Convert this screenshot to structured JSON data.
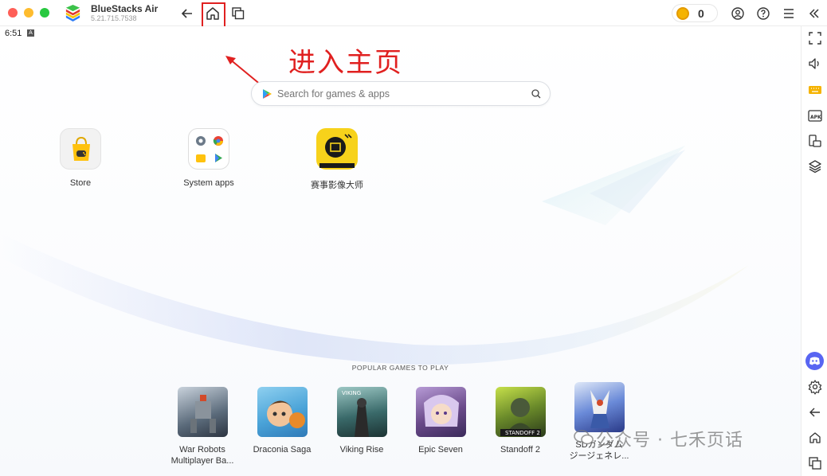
{
  "titlebar": {
    "app_name": "BlueStacks Air",
    "app_version": "5.21.715.7538",
    "coin_count": "0",
    "icons": [
      "back-arrow-icon",
      "home-icon",
      "multi-instance-icon",
      "coin-icon",
      "account-icon",
      "help-icon",
      "menu-icon",
      "collapse-sidebar-icon"
    ]
  },
  "status": {
    "time": "6:51",
    "indicator": "A"
  },
  "annotation": {
    "text": "进入主页",
    "color": "#e02020"
  },
  "search": {
    "placeholder": "Search for games & apps"
  },
  "apps": [
    {
      "label": "Store",
      "icon": "store-bag-icon"
    },
    {
      "label": "System apps",
      "icon": "system-apps-folder-icon"
    },
    {
      "label": "赛事影像大师",
      "icon": "video-master-icon"
    }
  ],
  "popular": {
    "title": "POPULAR GAMES TO PLAY",
    "games": [
      {
        "label_line1": "War Robots",
        "label_line2": "Multiplayer Ba...",
        "color": "#5a6a7a"
      },
      {
        "label_line1": "Draconia Saga",
        "label_line2": "",
        "color": "#4aa3d8"
      },
      {
        "label_line1": "Viking Rise",
        "label_line2": "",
        "color": "#3a6a6a"
      },
      {
        "label_line1": "Epic Seven",
        "label_line2": "",
        "color": "#6a4a8a"
      },
      {
        "label_line1": "Standoff 2",
        "label_line2": "",
        "color": "#3a4a2a"
      },
      {
        "label_line1": "SDガンダム",
        "label_line2": "ジージェネレ...",
        "color": "#3a5aa8"
      }
    ]
  },
  "sidebar": {
    "icons": [
      "fullscreen-icon",
      "volume-icon",
      "keyboard-icon",
      "apk-install-icon",
      "rotate-icon",
      "layers-icon",
      "discord-icon",
      "settings-icon",
      "back-icon",
      "home-icon",
      "recent-apps-icon"
    ]
  },
  "watermark": {
    "text": "公众号 · 七禾页话"
  },
  "colors": {
    "accent_red": "#e02020",
    "coin": "#f5b300",
    "discord": "#5865f2"
  }
}
